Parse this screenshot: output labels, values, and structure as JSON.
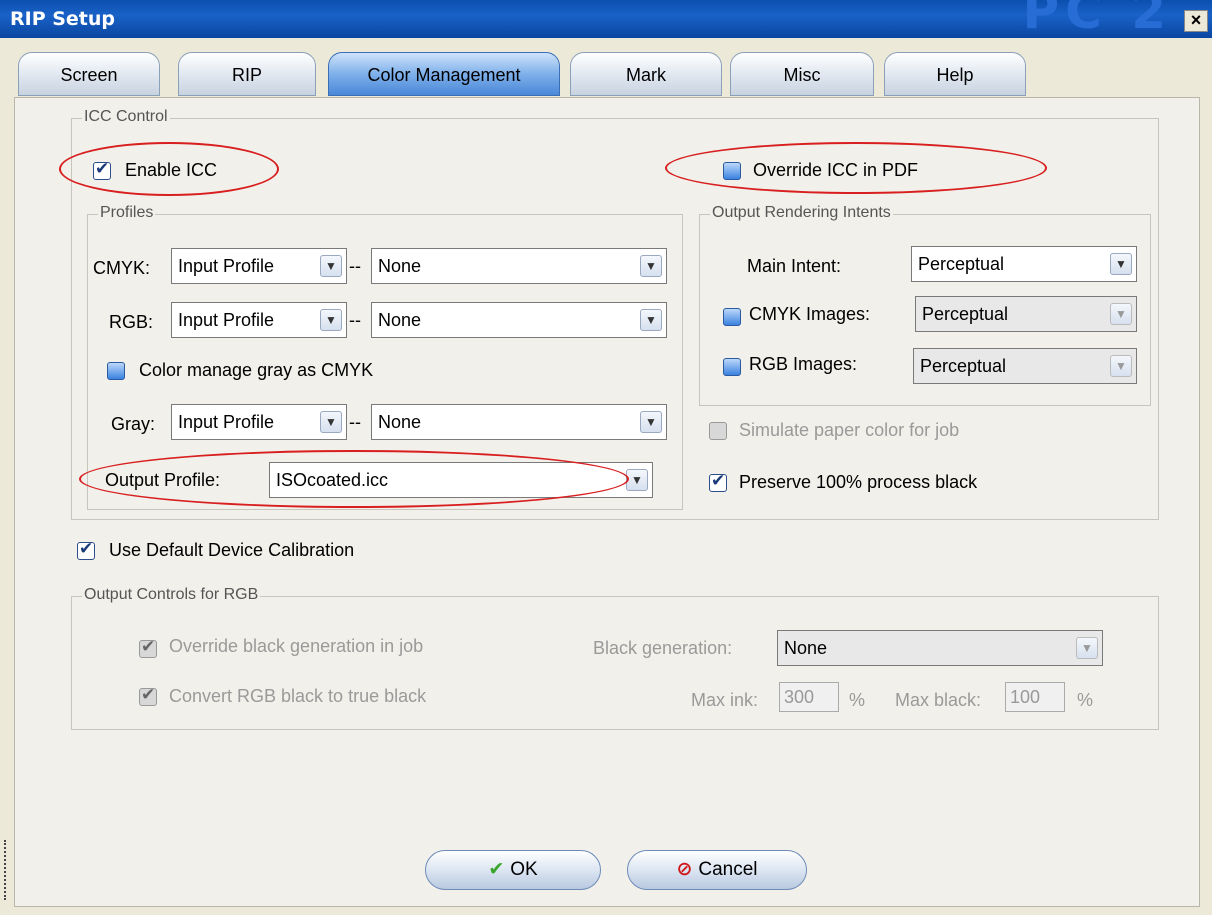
{
  "window": {
    "title": "RIP Setup",
    "brand_text": "PC 2",
    "close": "×"
  },
  "tabs": [
    {
      "label": "Screen"
    },
    {
      "label": "RIP"
    },
    {
      "label": "Color Management",
      "active": true
    },
    {
      "label": "Mark"
    },
    {
      "label": "Misc"
    },
    {
      "label": "Help"
    }
  ],
  "icc_control": {
    "legend": "ICC Control",
    "enable_icc": {
      "label": "Enable ICC",
      "checked": true
    },
    "override_icc": {
      "label": "Override ICC in PDF",
      "checked": false
    }
  },
  "profiles": {
    "legend": "Profiles",
    "cmyk": {
      "label": "CMYK:",
      "source": "Input Profile",
      "profile": "None"
    },
    "rgb": {
      "label": "RGB:",
      "source": "Input Profile",
      "profile": "None"
    },
    "gray_as_cmyk": {
      "label": "Color manage gray as CMYK",
      "checked": false
    },
    "gray": {
      "label": "Gray:",
      "source": "Input Profile",
      "profile": "None"
    },
    "separator": "--",
    "output_profile": {
      "label": "Output Profile:",
      "value": "ISOcoated.icc"
    }
  },
  "rendering_intents": {
    "legend": "Output Rendering Intents",
    "main": {
      "label": "Main Intent:",
      "value": "Perceptual"
    },
    "cmyk_images": {
      "label": "CMYK Images:",
      "value": "Perceptual",
      "checked": false
    },
    "rgb_images": {
      "label": "RGB Images:",
      "value": "Perceptual",
      "checked": false
    }
  },
  "simulate_paper": {
    "label": "Simulate paper color for job",
    "checked": false,
    "enabled": false
  },
  "preserve_black": {
    "label": "Preserve 100% process black",
    "checked": true
  },
  "use_default_calibration": {
    "label": "Use Default Device Calibration",
    "checked": true
  },
  "output_controls": {
    "legend": "Output Controls for RGB",
    "override_black_gen": {
      "label": "Override black generation in job",
      "checked": true
    },
    "convert_rgb_black": {
      "label": "Convert RGB black to true black",
      "checked": true
    },
    "black_generation": {
      "label": "Black generation:",
      "value": "None"
    },
    "max_ink": {
      "label": "Max ink:",
      "value": "300",
      "unit": "%"
    },
    "max_black": {
      "label": "Max black:",
      "value": "100",
      "unit": "%"
    }
  },
  "buttons": {
    "ok": "OK",
    "cancel": "Cancel"
  },
  "colors": {
    "accent_titlebar": "#0b4fae",
    "highlight_oval": "#d81e1e",
    "ok_icon": "#3aa62e",
    "cancel_icon": "#d01818"
  },
  "icons": {
    "ok": "check-icon",
    "cancel": "no-entry-icon",
    "dropdown": "chevron-down-icon"
  }
}
